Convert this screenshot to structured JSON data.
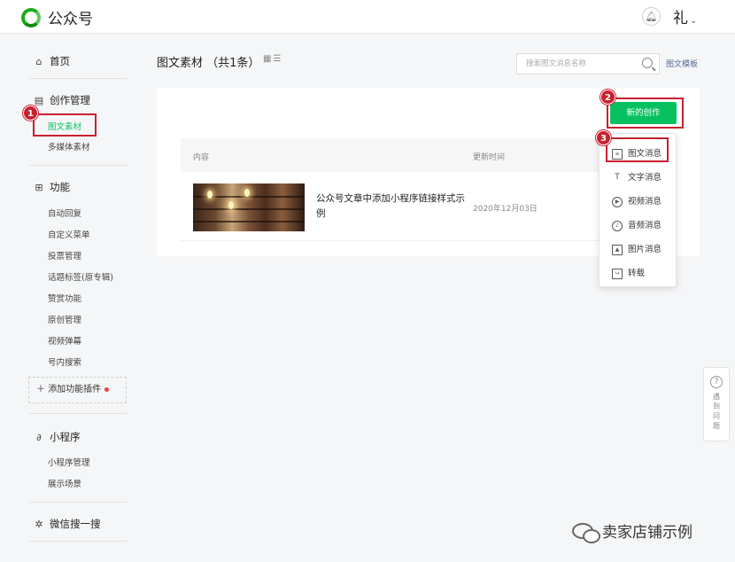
{
  "topbar": {
    "logo_text": "公众号",
    "bell_icon": "bell-icon",
    "account_initial": "礼",
    "account_caret": "⌄"
  },
  "sidebar": {
    "home": "首页",
    "creation_header": "创作管理",
    "creation_items": [
      "图文素材",
      "多媒体素材"
    ],
    "features_header": "功能",
    "features_items": [
      "自动回复",
      "自定义菜单",
      "投票管理",
      "话题标签(原专辑)",
      "赞赏功能",
      "原创管理",
      "视频弹幕",
      "号内搜索"
    ],
    "add_plugin": "添加功能插件",
    "miniprogram_header": "小程序",
    "miniprogram_items": [
      "小程序管理",
      "展示场景"
    ],
    "wechat_search": "微信搜一搜"
  },
  "content": {
    "title": "图文素材 （共1条）",
    "search_placeholder": "搜索图文消息名称",
    "template_link": "图文模板",
    "new_button": "新的创作",
    "table_headers": {
      "content": "内容",
      "updated": "更新时间"
    },
    "rows": [
      {
        "title": "公众号文章中添加小程序链接样式示例",
        "date": "2020年12月03日"
      }
    ]
  },
  "dropdown": {
    "items": [
      {
        "label": "图文消息",
        "icon": "doc-icon"
      },
      {
        "label": "文字消息",
        "icon": "text-icon"
      },
      {
        "label": "视频消息",
        "icon": "play-icon"
      },
      {
        "label": "音频消息",
        "icon": "audio-icon"
      },
      {
        "label": "图片消息",
        "icon": "image-icon"
      },
      {
        "label": "转载",
        "icon": "repost-icon"
      }
    ]
  },
  "markers": [
    "1",
    "2",
    "3"
  ],
  "feedback": {
    "label_lines": [
      "遇",
      "到",
      "问",
      "题"
    ]
  },
  "watermark": "卖家店铺示例",
  "colors": {
    "brand_green": "#07c160",
    "annotation_red": "#c8202f",
    "link_blue": "#576b95"
  }
}
